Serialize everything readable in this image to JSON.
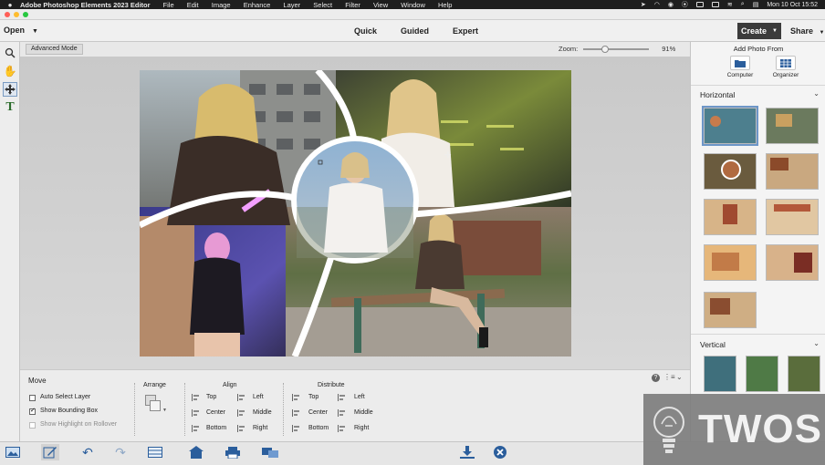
{
  "menubar": {
    "app_name": "Adobe Photoshop Elements 2023 Editor",
    "menus": [
      "File",
      "Edit",
      "Image",
      "Enhance",
      "Layer",
      "Select",
      "Filter",
      "View",
      "Window",
      "Help"
    ],
    "clock": "Mon 10 Oct  15:52"
  },
  "topbar": {
    "open_label": "Open",
    "modes": [
      "Quick",
      "Guided",
      "Expert"
    ],
    "create_label": "Create",
    "share_label": "Share"
  },
  "subbar": {
    "advanced_mode": "Advanced Mode",
    "zoom_label": "Zoom:",
    "zoom_value": "91%",
    "zoom_fraction": 0.32
  },
  "tool_options": {
    "title": "Move",
    "checkboxes": [
      {
        "label": "Auto Select Layer",
        "checked": false
      },
      {
        "label": "Show Bounding Box",
        "checked": true
      },
      {
        "label": "Show Highlight on Rollover",
        "checked": false
      }
    ],
    "arrange_label": "Arrange",
    "align_label": "Align",
    "align_items": [
      "Top",
      "Center",
      "Bottom",
      "Left",
      "Middle",
      "Right"
    ],
    "distribute_label": "Distribute",
    "distribute_items": [
      "Top",
      "Center",
      "Bottom",
      "Left",
      "Middle",
      "Right"
    ]
  },
  "right_panel": {
    "add_photo_from": "Add Photo From",
    "sources": [
      "Computer",
      "Organizer"
    ],
    "section_horizontal": "Horizontal",
    "section_vertical": "Vertical"
  },
  "watermark": {
    "text": "TWOS"
  },
  "colors": {
    "accent_blue": "#2b5e9c",
    "create_bg": "#3b3b3b"
  }
}
